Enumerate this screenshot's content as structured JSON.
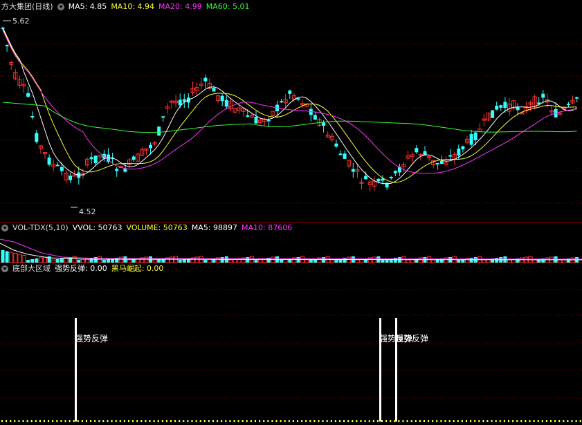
{
  "main": {
    "title": "方大集团(日线)",
    "ma_items": [
      {
        "label": "MA5: 4.85",
        "color": "#ffffff"
      },
      {
        "label": "MA10: 4.94",
        "color": "#ffff33"
      },
      {
        "label": "MA20: 4.99",
        "color": "#ff33ff"
      },
      {
        "label": "MA60: 5.01",
        "color": "#33ff33"
      }
    ],
    "high_label": "5.62",
    "low_label": "4.52"
  },
  "volume": {
    "title": "VOL-TDX(5,10)",
    "items": [
      {
        "label": "VVOL: 50763",
        "color": "#ffffff"
      },
      {
        "label": "VOLUME: 50763",
        "color": "#ffff33"
      },
      {
        "label": "MA5: 98897",
        "color": "#ffffff"
      },
      {
        "label": "MA10: 87606",
        "color": "#ff33ff"
      }
    ]
  },
  "indicator": {
    "title": "底部大区域",
    "items": [
      {
        "label": "强势反弹: 0.00",
        "color": "#ffffff"
      },
      {
        "label": "黑马崛起: 0.00",
        "color": "#ffff33"
      }
    ],
    "signal_label": "强势反弹"
  },
  "colors": {
    "up": "#ff3333",
    "down": "#33ffff",
    "ma5": "#ffffff",
    "ma10": "#ffff33",
    "ma20": "#ff33ff",
    "ma60": "#33ff33",
    "grid": "#8b0000"
  }
}
